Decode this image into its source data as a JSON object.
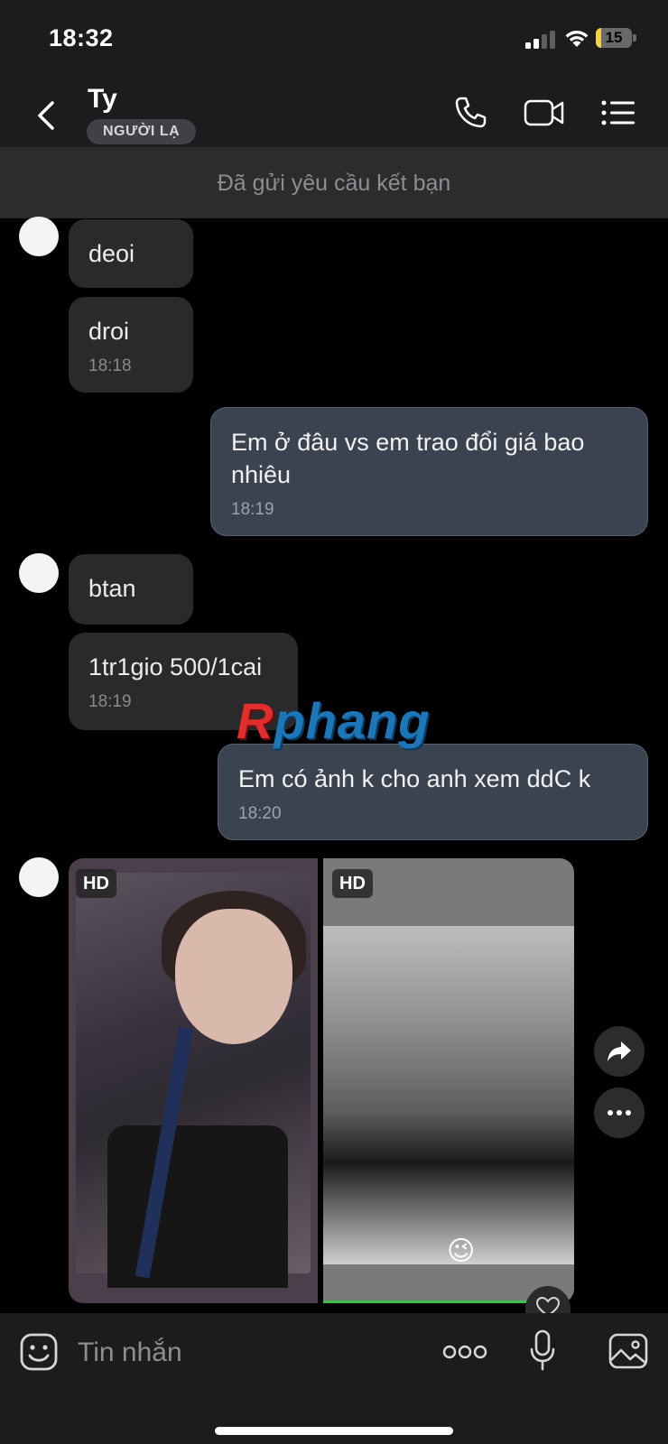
{
  "status_bar": {
    "time": "18:32",
    "battery_level": "15",
    "battery_fraction": 0.15
  },
  "header": {
    "name": "Ty",
    "badge": "NGƯỜI LẠ",
    "icons": [
      "back-icon",
      "phone-icon",
      "video-call-icon",
      "menu-icon"
    ]
  },
  "banner": {
    "text": "Đã gửi yêu cầu kết bạn"
  },
  "messages": [
    {
      "dir": "in",
      "text": "deoi",
      "time": ""
    },
    {
      "dir": "in",
      "text": "droi",
      "time": "18:18"
    },
    {
      "dir": "out",
      "text": "Em ở đâu vs em trao đổi giá bao nhiêu",
      "time": "18:19"
    },
    {
      "dir": "in",
      "text": "btan",
      "time": ""
    },
    {
      "dir": "in",
      "text": "1tr1gio 500/1cai",
      "time": "18:19"
    },
    {
      "dir": "out",
      "text": "Em có ảnh k cho anh xem ddC k",
      "time": "18:20"
    }
  ],
  "media": {
    "badge_left": "HD",
    "badge_right": "HD",
    "sticker_right": "😉"
  },
  "watermark": {
    "prefix": "R",
    "rest": "phang"
  },
  "actions": [
    "forward-icon",
    "more-options-icon",
    "heart-icon"
  ],
  "input": {
    "placeholder": "Tin nhắn"
  },
  "colors": {
    "bubble_in": "#2a2a2c",
    "bubble_out": "#3b4250",
    "header_bg": "#1c1c1e",
    "battery": "#f2d249"
  }
}
